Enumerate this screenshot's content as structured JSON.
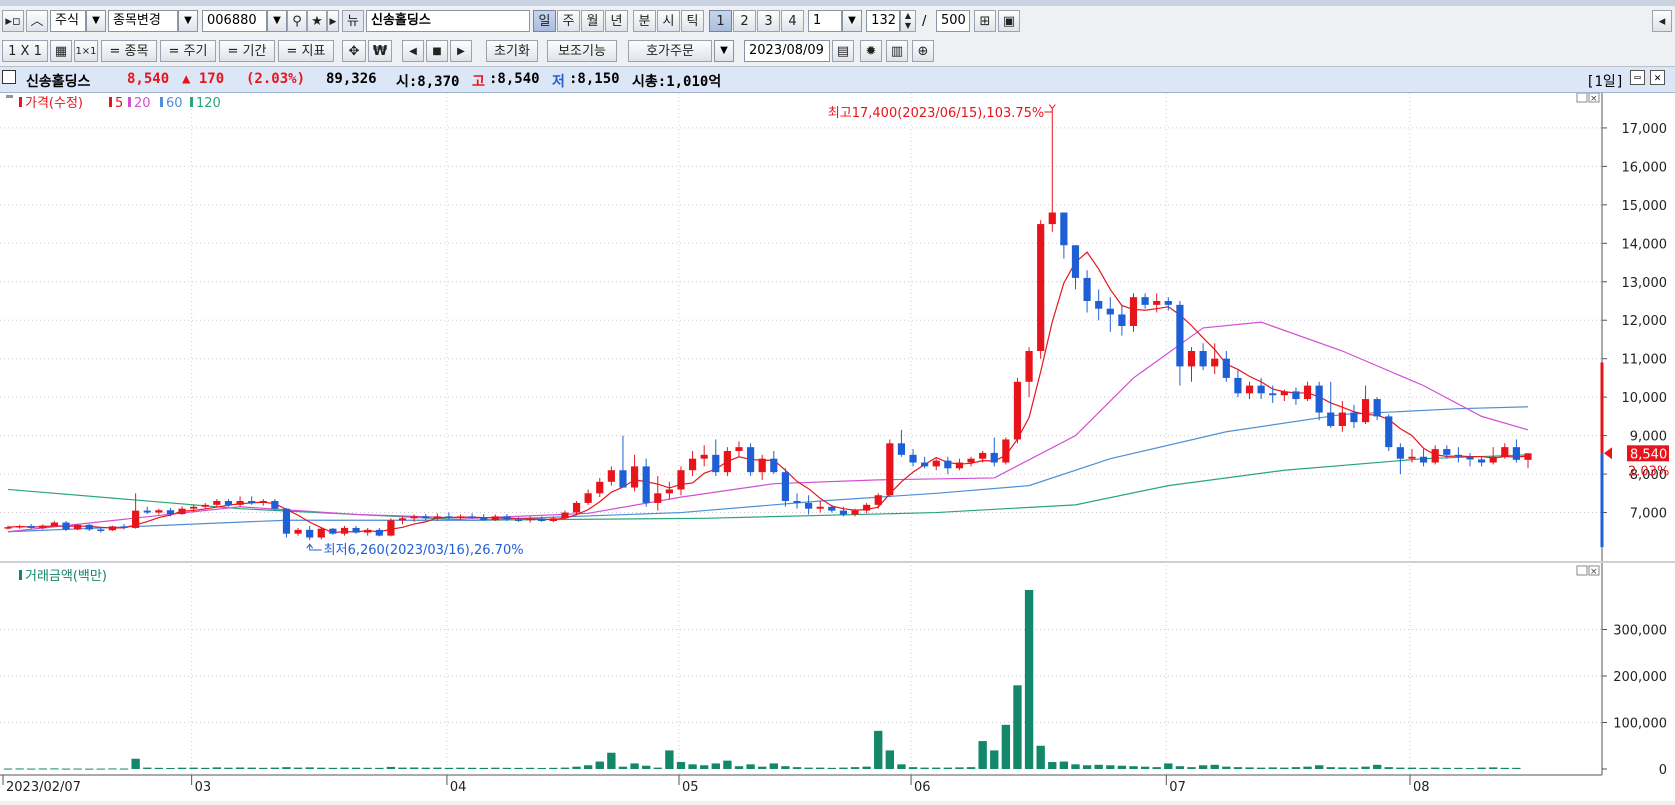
{
  "toolbar1": {
    "market": "주식",
    "change_label": "종목변경",
    "code": "006880",
    "news": "뉴",
    "name": "신송홀딩스",
    "periods": [
      "일",
      "주",
      "월",
      "년",
      "분",
      "시",
      "틱"
    ],
    "nums": [
      "1",
      "2",
      "3",
      "4"
    ],
    "unit": "1",
    "count": "132",
    "slash": "/",
    "total": "500"
  },
  "toolbar2": {
    "layout": "1 X 1",
    "btn_stock": "= 종목",
    "btn_period": "= 주기",
    "btn_range": "= 기간",
    "btn_indicator": "= 지표",
    "won": "₩",
    "reset": "초기화",
    "aux": "보조기능",
    "order": "호가주문",
    "date": "2023/08/09"
  },
  "info": {
    "name": "신송홀딩스",
    "price": "8,540",
    "change": "▲ 170",
    "pct": "(2.03%)",
    "volume": "89,326",
    "open": "시:8,370",
    "high_label": "고",
    "high_value": ":8,540",
    "low_label": "저",
    "low_value": ":8,150",
    "mktcap": "시총:1,010억",
    "period_tag": "[1일]"
  },
  "chart_data": [
    {
      "type": "candlestick",
      "legend": [
        "가격(수정)",
        "5",
        "20",
        "60",
        "120"
      ],
      "colors": {
        "up": "#e8141c",
        "down": "#1f5fd6",
        "ma5": "#e8141c",
        "ma20": "#d24fd2",
        "ma60": "#4f8fd6",
        "ma120": "#2aa57a"
      },
      "ylim": [
        6000,
        17700
      ],
      "yticks": [
        7000,
        8000,
        9000,
        10000,
        11000,
        12000,
        13000,
        14000,
        15000,
        16000,
        17000
      ],
      "ytick_labels": [
        "7,000",
        "8,000",
        "9,000",
        "10,000",
        "11,000",
        "12,000",
        "13,000",
        "14,000",
        "15,000",
        "16,000",
        "17,000"
      ],
      "x_labels": [
        "2023/02/07",
        "03",
        "04",
        "05",
        "06",
        "07",
        "08"
      ],
      "x_label_index": [
        0,
        16,
        38,
        58,
        78,
        100,
        121
      ],
      "annotation_high": "최고17,400(2023/06/15),103.75%",
      "annotation_low": "최저6,260(2023/03/16),26.70%",
      "last_price_tag": "8,540",
      "last_pct_tag": "2.03%",
      "ohlc": [
        [
          6600,
          6660,
          6560,
          6620
        ],
        [
          6620,
          6680,
          6580,
          6650
        ],
        [
          6650,
          6700,
          6580,
          6600
        ],
        [
          6600,
          6690,
          6560,
          6660
        ],
        [
          6660,
          6780,
          6640,
          6740
        ],
        [
          6740,
          6780,
          6520,
          6560
        ],
        [
          6560,
          6700,
          6540,
          6680
        ],
        [
          6680,
          6700,
          6520,
          6560
        ],
        [
          6560,
          6620,
          6480,
          6540
        ],
        [
          6540,
          6660,
          6520,
          6640
        ],
        [
          6640,
          6700,
          6560,
          6600
        ],
        [
          6600,
          7500,
          6580,
          7050
        ],
        [
          7050,
          7150,
          6960,
          7000
        ],
        [
          7000,
          7100,
          6950,
          7060
        ],
        [
          7060,
          7120,
          6900,
          6960
        ],
        [
          6960,
          7160,
          6940,
          7100
        ],
        [
          7100,
          7200,
          7000,
          7150
        ],
        [
          7150,
          7250,
          7080,
          7200
        ],
        [
          7200,
          7350,
          7140,
          7300
        ],
        [
          7300,
          7350,
          7150,
          7200
        ],
        [
          7200,
          7420,
          7150,
          7300
        ],
        [
          7300,
          7420,
          7200,
          7250
        ],
        [
          7250,
          7350,
          7180,
          7300
        ],
        [
          7300,
          7350,
          7050,
          7100
        ],
        [
          7100,
          7120,
          6350,
          6450
        ],
        [
          6450,
          6600,
          6400,
          6550
        ],
        [
          6550,
          6650,
          6280,
          6350
        ],
        [
          6350,
          6620,
          6300,
          6580
        ],
        [
          6580,
          6600,
          6420,
          6450
        ],
        [
          6450,
          6650,
          6400,
          6600
        ],
        [
          6600,
          6650,
          6450,
          6480
        ],
        [
          6480,
          6600,
          6400,
          6550
        ],
        [
          6550,
          6600,
          6380,
          6400
        ],
        [
          6400,
          6850,
          6380,
          6800
        ],
        [
          6800,
          6900,
          6700,
          6850
        ],
        [
          6850,
          6950,
          6760,
          6900
        ],
        [
          6900,
          6960,
          6800,
          6850
        ],
        [
          6850,
          6980,
          6780,
          6900
        ],
        [
          6900,
          7000,
          6820,
          6860
        ],
        [
          6860,
          6950,
          6800,
          6900
        ],
        [
          6900,
          6980,
          6840,
          6880
        ],
        [
          6880,
          6960,
          6780,
          6800
        ],
        [
          6800,
          6950,
          6780,
          6900
        ],
        [
          6900,
          6960,
          6780,
          6820
        ],
        [
          6820,
          6880,
          6760,
          6800
        ],
        [
          6800,
          6900,
          6740,
          6840
        ],
        [
          6840,
          6900,
          6760,
          6780
        ],
        [
          6780,
          6900,
          6750,
          6850
        ],
        [
          6850,
          7050,
          6820,
          7000
        ],
        [
          7000,
          7300,
          6950,
          7250
        ],
        [
          7250,
          7600,
          7200,
          7500
        ],
        [
          7500,
          7900,
          7400,
          7800
        ],
        [
          7800,
          8200,
          7700,
          8100
        ],
        [
          8100,
          9000,
          7950,
          7650
        ],
        [
          7650,
          8500,
          7550,
          8200
        ],
        [
          8200,
          8400,
          7150,
          7250
        ],
        [
          7250,
          7950,
          7050,
          7500
        ],
        [
          7500,
          7800,
          7350,
          7600
        ],
        [
          7600,
          8200,
          7450,
          8100
        ],
        [
          8100,
          8600,
          7950,
          8400
        ],
        [
          8400,
          8750,
          8200,
          8500
        ],
        [
          8500,
          8900,
          7950,
          8050
        ],
        [
          8050,
          8700,
          7950,
          8600
        ],
        [
          8600,
          8850,
          8450,
          8700
        ],
        [
          8700,
          8800,
          7950,
          8050
        ],
        [
          8050,
          8500,
          7850,
          8400
        ],
        [
          8400,
          8600,
          8000,
          8050
        ],
        [
          8050,
          8150,
          7150,
          7300
        ],
        [
          7300,
          7500,
          7100,
          7250
        ],
        [
          7250,
          7450,
          6950,
          7100
        ],
        [
          7100,
          7300,
          7000,
          7150
        ],
        [
          7150,
          7200,
          7000,
          7050
        ],
        [
          7050,
          7150,
          6900,
          6950
        ],
        [
          6950,
          7100,
          6900,
          7050
        ],
        [
          7050,
          7250,
          6980,
          7200
        ],
        [
          7200,
          7500,
          7100,
          7450
        ],
        [
          7450,
          8900,
          7400,
          8800
        ],
        [
          8800,
          9150,
          8450,
          8500
        ],
        [
          8500,
          8650,
          8200,
          8300
        ],
        [
          8300,
          8450,
          8150,
          8200
        ],
        [
          8200,
          8400,
          8100,
          8350
        ],
        [
          8350,
          8450,
          8000,
          8150
        ],
        [
          8150,
          8400,
          8100,
          8300
        ],
        [
          8300,
          8450,
          8200,
          8400
        ],
        [
          8400,
          8600,
          8300,
          8550
        ],
        [
          8550,
          8950,
          8200,
          8300
        ],
        [
          8300,
          8950,
          8250,
          8900
        ],
        [
          8900,
          10500,
          8800,
          10400
        ],
        [
          10400,
          11300,
          10000,
          11200
        ],
        [
          11200,
          14600,
          11000,
          14500
        ],
        [
          14500,
          17400,
          14300,
          14800
        ],
        [
          14800,
          14800,
          13600,
          13950
        ],
        [
          13950,
          13950,
          12800,
          13100
        ],
        [
          13100,
          13300,
          12200,
          12500
        ],
        [
          12500,
          12800,
          12000,
          12300
        ],
        [
          12300,
          12600,
          11700,
          12150
        ],
        [
          12150,
          12400,
          11600,
          11850
        ],
        [
          11850,
          12700,
          11700,
          12600
        ],
        [
          12600,
          12700,
          12300,
          12400
        ],
        [
          12400,
          12700,
          12200,
          12500
        ],
        [
          12500,
          12600,
          12250,
          12400
        ],
        [
          12400,
          12500,
          10300,
          10800
        ],
        [
          10800,
          11300,
          10400,
          11200
        ],
        [
          11200,
          11400,
          10700,
          10800
        ],
        [
          10800,
          11400,
          10600,
          11000
        ],
        [
          11000,
          11200,
          10400,
          10500
        ],
        [
          10500,
          10700,
          10000,
          10100
        ],
        [
          10100,
          10400,
          9950,
          10300
        ],
        [
          10300,
          10500,
          9950,
          10100
        ],
        [
          10100,
          10300,
          9850,
          10050
        ],
        [
          10050,
          10200,
          9900,
          10150
        ],
        [
          10150,
          10250,
          9800,
          9950
        ],
        [
          9950,
          10400,
          9900,
          10300
        ],
        [
          10300,
          10400,
          9400,
          9600
        ],
        [
          9600,
          10400,
          9200,
          9250
        ],
        [
          9250,
          9900,
          9100,
          9600
        ],
        [
          9600,
          9800,
          9200,
          9350
        ],
        [
          9350,
          10300,
          9300,
          9950
        ],
        [
          9950,
          10000,
          9400,
          9500
        ],
        [
          9500,
          9550,
          8600,
          8700
        ],
        [
          8700,
          8800,
          8000,
          8400
        ],
        [
          8400,
          8650,
          8300,
          8450
        ],
        [
          8450,
          8650,
          8200,
          8300
        ],
        [
          8300,
          8750,
          8250,
          8650
        ],
        [
          8650,
          8750,
          8400,
          8500
        ],
        [
          8500,
          8700,
          8300,
          8450
        ],
        [
          8450,
          8550,
          8200,
          8380
        ],
        [
          8380,
          8450,
          8200,
          8300
        ],
        [
          8300,
          8700,
          8250,
          8450
        ],
        [
          8450,
          8800,
          8400,
          8700
        ],
        [
          8700,
          8900,
          8300,
          8370
        ],
        [
          8370,
          8540,
          8150,
          8540
        ]
      ],
      "ma_src": {
        "ma20": [
          [
            0,
            6500
          ],
          [
            20,
            7150
          ],
          [
            30,
            6950
          ],
          [
            40,
            6850
          ],
          [
            50,
            6980
          ],
          [
            58,
            7400
          ],
          [
            66,
            7750
          ],
          [
            75,
            7850
          ],
          [
            85,
            7900
          ],
          [
            92,
            9000
          ],
          [
            97,
            10500
          ],
          [
            103,
            11800
          ],
          [
            108,
            11950
          ],
          [
            115,
            11200
          ],
          [
            122,
            10300
          ],
          [
            127,
            9500
          ],
          [
            131,
            9150
          ]
        ],
        "ma60": [
          [
            0,
            6500
          ],
          [
            24,
            6800
          ],
          [
            40,
            6800
          ],
          [
            58,
            7000
          ],
          [
            70,
            7300
          ],
          [
            80,
            7500
          ],
          [
            88,
            7700
          ],
          [
            95,
            8400
          ],
          [
            105,
            9100
          ],
          [
            115,
            9550
          ],
          [
            125,
            9700
          ],
          [
            131,
            9750
          ]
        ],
        "ma120": [
          [
            0,
            7600
          ],
          [
            20,
            7100
          ],
          [
            40,
            6800
          ],
          [
            60,
            6850
          ],
          [
            80,
            7000
          ],
          [
            92,
            7200
          ],
          [
            100,
            7700
          ],
          [
            110,
            8100
          ],
          [
            122,
            8400
          ],
          [
            131,
            8500
          ]
        ]
      }
    },
    {
      "type": "bar",
      "legend": "거래금액(백만)",
      "color": "#12876a",
      "ylim": [
        0,
        400000
      ],
      "yticks": [
        0,
        100000,
        200000,
        300000
      ],
      "ytick_labels": [
        "0",
        "100,000",
        "200,000",
        "300,000"
      ],
      "values": [
        1000,
        1200,
        900,
        1100,
        1300,
        900,
        1000,
        800,
        900,
        1200,
        1000,
        22000,
        3000,
        2500,
        2200,
        2800,
        3000,
        2500,
        3500,
        2800,
        3200,
        3000,
        2500,
        3000,
        4000,
        3000,
        3500,
        2800,
        2500,
        3000,
        2800,
        2600,
        2500,
        4500,
        3000,
        3200,
        2800,
        3000,
        2500,
        2800,
        2600,
        2400,
        2800,
        2500,
        2400,
        2600,
        2300,
        2500,
        3000,
        5000,
        8000,
        16000,
        35000,
        5000,
        12000,
        7000,
        3000,
        40000,
        15000,
        10000,
        8000,
        12000,
        18000,
        6000,
        10000,
        5000,
        12000,
        6000,
        4000,
        3000,
        3000,
        2500,
        3000,
        4000,
        5000,
        82000,
        40000,
        10000,
        4000,
        3000,
        3000,
        3000,
        3500,
        4000,
        60000,
        40000,
        95000,
        180000,
        385000,
        50000,
        15000,
        16000,
        10000,
        8000,
        9000,
        8000,
        7000,
        6000,
        5000,
        4000,
        12000,
        6000,
        4000,
        8000,
        9000,
        5000,
        4000,
        3500,
        3000,
        3500,
        3000,
        4000,
        5000,
        8000,
        4000,
        3500,
        3000,
        5000,
        9000,
        4000,
        3000,
        3000,
        2500,
        3000,
        2500,
        2500,
        2000,
        3000,
        3500,
        2500,
        2500
      ]
    }
  ]
}
